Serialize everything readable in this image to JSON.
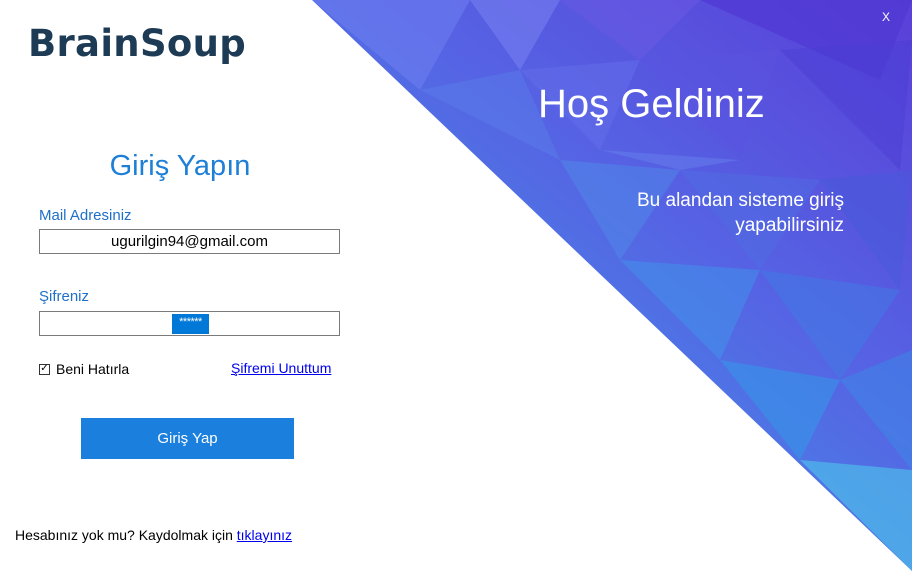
{
  "brand": {
    "logo_text": "BrainSoup"
  },
  "login": {
    "title": "Giriş Yapın",
    "email_label": "Mail Adresiniz",
    "email_value": "ugurilgin94@gmail.com",
    "password_label": "Şifreniz",
    "password_mask": "******",
    "remember_label": "Beni Hatırla",
    "remember_checked": "✓",
    "forgot_label": "Şifremi Unuttum",
    "submit_label": "Giriş Yap"
  },
  "signup": {
    "prompt": "Hesabınız yok mu? Kaydolmak için ",
    "link_label": "tıklayınız"
  },
  "welcome": {
    "title": "Hoş Geldiniz",
    "line1": "Bu alandan sisteme giriş",
    "line2": "yapabilirsiniz"
  },
  "window": {
    "close_label": "X"
  },
  "colors": {
    "accent": "#1a7fdd",
    "brand": "#1d3b55",
    "panel_light": "#4aa3e6",
    "panel_dark": "#5a3fd8"
  }
}
